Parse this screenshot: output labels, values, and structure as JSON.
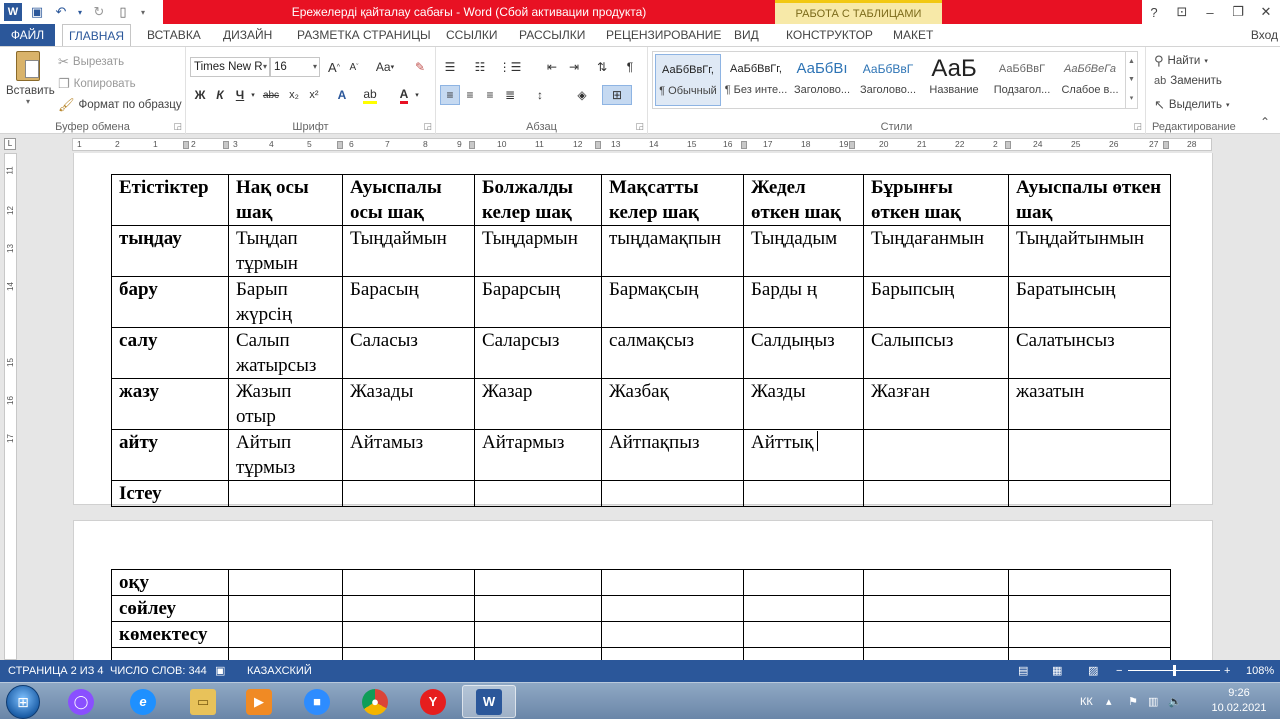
{
  "titlebar": {
    "title": "Ережелерді қайталау сабағы -  Word (Сбой активации продукта)",
    "table_tools": "РАБОТА С ТАБЛИЦАМИ",
    "help": "?",
    "ribbon_options": "⊡",
    "minimize": "–",
    "restore": "❐",
    "close": "✕"
  },
  "tabs": {
    "file": "ФАЙЛ",
    "home": "ГЛАВНАЯ",
    "insert": "ВСТАВКА",
    "design": "ДИЗАЙН",
    "layout": "РАЗМЕТКА СТРАНИЦЫ",
    "references": "ССЫЛКИ",
    "mailings": "РАССЫЛКИ",
    "review": "РЕЦЕНЗИРОВАНИЕ",
    "view": "ВИД",
    "constructor": "КОНСТРУКТОР",
    "table_layout": "МАКЕТ",
    "signin": "Вход"
  },
  "clipboard": {
    "paste": "Вставить",
    "cut": "Вырезать",
    "copy": "Копировать",
    "format_painter": "Формат по образцу",
    "label": "Буфер обмена"
  },
  "font": {
    "name": "Times New R",
    "size": "16",
    "grow": "A",
    "shrink": "A",
    "case": "Aa",
    "bold": "Ж",
    "italic": "К",
    "underline": "Ч",
    "strike": "abc",
    "subscript": "x₂",
    "superscript": "x²",
    "label": "Шрифт"
  },
  "paragraph": {
    "label": "Абзац"
  },
  "styles": {
    "label": "Стили",
    "items": [
      {
        "sample": "АаБбВвГг,",
        "name": "¶ Обычный"
      },
      {
        "sample": "АаБбВвГг,",
        "name": "¶ Без инте..."
      },
      {
        "sample": "АаБбВı",
        "name": "Заголово..."
      },
      {
        "sample": "АаБбВвГ",
        "name": "Заголово..."
      },
      {
        "sample": "АаБ",
        "name": "Название"
      },
      {
        "sample": "АаБбВвГ",
        "name": "Подзагол..."
      },
      {
        "sample": "АаБбВеГа",
        "name": "Слабое в..."
      }
    ]
  },
  "editing": {
    "find": "Найти",
    "replace": "Заменить",
    "select": "Выделить",
    "label": "Редактирование"
  },
  "ruler": {
    "numbers": [
      "1",
      "2",
      "1",
      "2",
      "3",
      "4",
      "5",
      "6",
      "7",
      "8",
      "9",
      "10",
      "11",
      "12",
      "13",
      "14",
      "15",
      "16",
      "17",
      "18",
      "19",
      "20",
      "21",
      "22",
      "2",
      "24",
      "25",
      "26",
      "27",
      "28"
    ],
    "vnumbers": [
      "11",
      "12",
      "13",
      "14",
      "15",
      "16",
      "17",
      "18"
    ]
  },
  "table1": {
    "header": [
      "Етістіктер",
      "Нақ осы шақ",
      "Ауыспалы осы шақ",
      "Болжалды келер шақ",
      "Мақсатты келер шақ",
      "Жедел өткен шақ",
      "Бұрынғы өткен шақ",
      "Ауыспалы өткен шақ"
    ],
    "rows": [
      [
        "тыңдау",
        "Тыңдап тұрмын",
        "Тыңдаймын",
        "Тыңдармын",
        "тыңдамақпын",
        "Тыңдадым",
        "Тыңдағанмын",
        "Тыңдайтынмын"
      ],
      [
        "бару",
        "Барып жүрсің",
        "Барасың",
        "Барарсың",
        "Бармақсың",
        "Барды ң",
        "Барыпсың",
        "Баратынсың"
      ],
      [
        "салу",
        "Салып жатырсыз",
        "Саласыз",
        "Саларсыз",
        "салмақсыз",
        "Салдыңыз",
        "Салыпсыз",
        "Салатынсыз"
      ],
      [
        "жазу",
        "Жазып отыр",
        "Жазады",
        "Жазар",
        "Жазбақ",
        "Жазды",
        "Жазған",
        "жазатын"
      ],
      [
        "айту",
        "Айтып тұрмыз",
        "Айтамыз",
        "Айтармыз",
        "Айтпақпыз",
        "Айттық",
        "",
        ""
      ],
      [
        "Істеу",
        "",
        "",
        "",
        "",
        "",
        "",
        ""
      ]
    ]
  },
  "table2": {
    "rows": [
      [
        "оқу",
        "",
        "",
        "",
        "",
        "",
        "",
        ""
      ],
      [
        "сөйлеу",
        "",
        "",
        "",
        "",
        "",
        "",
        ""
      ],
      [
        "көмектесу",
        "",
        "",
        "",
        "",
        "",
        "",
        ""
      ],
      [
        "",
        "",
        "",
        "",
        "",
        "",
        "",
        ""
      ]
    ]
  },
  "status": {
    "page": "СТРАНИЦА 2 ИЗ 4",
    "words": "ЧИСЛО СЛОВ: 344",
    "language": "КАЗАХСКИЙ",
    "zoom": "108%",
    "zoom_level_percent": 108
  },
  "tray": {
    "lang": "КК",
    "time": "9:26",
    "date": "10.02.2021"
  },
  "colors": {
    "word_blue": "#2b579a",
    "title_red": "#e81123",
    "table_tools_yellow": "#f7e9a8"
  }
}
